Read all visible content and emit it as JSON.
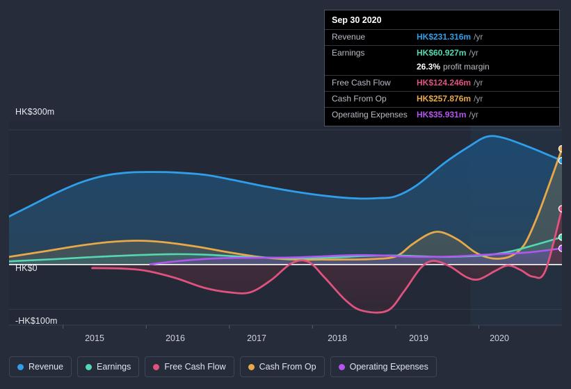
{
  "chart_data": {
    "type": "area",
    "title": "",
    "xlabel": "",
    "ylabel": "",
    "currency": "HK$",
    "xlim": [
      2014.35,
      2021.0
    ],
    "ylim": [
      -130,
      330
    ],
    "grid": true,
    "y_ticks": [
      {
        "value": 300,
        "label": "HK$300m"
      },
      {
        "value": 200,
        "label": ""
      },
      {
        "value": 100,
        "label": ""
      },
      {
        "value": 0,
        "label": "HK$0"
      },
      {
        "value": -100,
        "label": "-HK$100m"
      }
    ],
    "x_ticks": [
      {
        "value": 2015,
        "label": "2015"
      },
      {
        "value": 2016,
        "label": "2016"
      },
      {
        "value": 2017,
        "label": "2017"
      },
      {
        "value": 2018,
        "label": "2018"
      },
      {
        "value": 2019,
        "label": "2019"
      },
      {
        "value": 2020,
        "label": "2020"
      }
    ],
    "legend_position": "bottom-left",
    "series": [
      {
        "name": "Revenue",
        "color": "#2f9fea",
        "values": [
          [
            2014.35,
            107
          ],
          [
            2014.6,
            130
          ],
          [
            2014.9,
            158
          ],
          [
            2015.2,
            182
          ],
          [
            2015.5,
            198
          ],
          [
            2015.8,
            205
          ],
          [
            2016.1,
            206
          ],
          [
            2016.35,
            205
          ],
          [
            2016.7,
            200
          ],
          [
            2017.0,
            190
          ],
          [
            2017.4,
            175
          ],
          [
            2017.8,
            162
          ],
          [
            2018.2,
            152
          ],
          [
            2018.55,
            147
          ],
          [
            2018.8,
            148
          ],
          [
            2019.0,
            152
          ],
          [
            2019.25,
            176
          ],
          [
            2019.6,
            228
          ],
          [
            2019.9,
            265
          ],
          [
            2020.1,
            285
          ],
          [
            2020.3,
            282
          ],
          [
            2020.6,
            262
          ],
          [
            2020.85,
            243
          ],
          [
            2021.0,
            231.316
          ]
        ]
      },
      {
        "name": "Earnings",
        "color": "#55d8b1",
        "values": [
          [
            2014.35,
            7
          ],
          [
            2014.9,
            12
          ],
          [
            2015.4,
            17
          ],
          [
            2015.9,
            21
          ],
          [
            2016.3,
            23
          ],
          [
            2016.7,
            22
          ],
          [
            2017.1,
            18
          ],
          [
            2017.5,
            15
          ],
          [
            2017.9,
            14
          ],
          [
            2018.3,
            16
          ],
          [
            2018.6,
            19
          ],
          [
            2018.9,
            20
          ],
          [
            2019.2,
            19
          ],
          [
            2019.5,
            17
          ],
          [
            2019.8,
            18
          ],
          [
            2020.1,
            21
          ],
          [
            2020.4,
            30
          ],
          [
            2020.7,
            45
          ],
          [
            2021.0,
            60.927
          ]
        ]
      },
      {
        "name": "Free Cash Flow",
        "color": "#e0537f",
        "values": [
          [
            2015.35,
            -8
          ],
          [
            2015.7,
            -9
          ],
          [
            2016.0,
            -14
          ],
          [
            2016.35,
            -30
          ],
          [
            2016.7,
            -52
          ],
          [
            2017.0,
            -62
          ],
          [
            2017.25,
            -62
          ],
          [
            2017.5,
            -35
          ],
          [
            2017.75,
            3
          ],
          [
            2017.95,
            6
          ],
          [
            2018.15,
            -30
          ],
          [
            2018.4,
            -80
          ],
          [
            2018.6,
            -103
          ],
          [
            2018.9,
            -103
          ],
          [
            2019.1,
            -60
          ],
          [
            2019.3,
            -8
          ],
          [
            2019.45,
            8
          ],
          [
            2019.65,
            -4
          ],
          [
            2019.85,
            -28
          ],
          [
            2020.0,
            -33
          ],
          [
            2020.2,
            -14
          ],
          [
            2020.35,
            -2
          ],
          [
            2020.5,
            -12
          ],
          [
            2020.65,
            -27
          ],
          [
            2020.8,
            -14
          ],
          [
            2021.0,
            124.246
          ]
        ]
      },
      {
        "name": "Cash From Op",
        "color": "#e7a94a",
        "values": [
          [
            2014.35,
            17
          ],
          [
            2014.8,
            30
          ],
          [
            2015.2,
            42
          ],
          [
            2015.55,
            50
          ],
          [
            2015.9,
            53
          ],
          [
            2016.2,
            50
          ],
          [
            2016.6,
            40
          ],
          [
            2017.0,
            27
          ],
          [
            2017.4,
            16
          ],
          [
            2017.8,
            11
          ],
          [
            2018.1,
            11
          ],
          [
            2018.4,
            11
          ],
          [
            2018.7,
            12
          ],
          [
            2019.0,
            18
          ],
          [
            2019.2,
            45
          ],
          [
            2019.4,
            68
          ],
          [
            2019.55,
            72
          ],
          [
            2019.75,
            55
          ],
          [
            2019.95,
            28
          ],
          [
            2020.1,
            16
          ],
          [
            2020.25,
            13
          ],
          [
            2020.4,
            20
          ],
          [
            2020.55,
            45
          ],
          [
            2020.7,
            105
          ],
          [
            2020.85,
            180
          ],
          [
            2021.0,
            257.876
          ]
        ]
      },
      {
        "name": "Operating Expenses",
        "color": "#b355f0",
        "values": [
          [
            2016.05,
            0.5
          ],
          [
            2016.3,
            6
          ],
          [
            2016.6,
            11
          ],
          [
            2016.9,
            14
          ],
          [
            2017.2,
            15
          ],
          [
            2017.5,
            15
          ],
          [
            2017.8,
            16
          ],
          [
            2018.1,
            18
          ],
          [
            2018.35,
            20
          ],
          [
            2018.6,
            21
          ],
          [
            2018.85,
            20
          ],
          [
            2019.1,
            18
          ],
          [
            2019.4,
            17
          ],
          [
            2019.7,
            18
          ],
          [
            2020.0,
            21
          ],
          [
            2020.3,
            24
          ],
          [
            2020.6,
            27
          ],
          [
            2021.0,
            35.931
          ]
        ]
      }
    ],
    "end_markers": [
      {
        "series": "Cash From Op",
        "value": 257.876,
        "color": "#e7a94a"
      },
      {
        "series": "Revenue",
        "value": 231.316,
        "color": "#2f9fea"
      },
      {
        "series": "Free Cash Flow",
        "value": 124.246,
        "color": "#e0537f"
      },
      {
        "series": "Earnings",
        "value": 60.927,
        "color": "#55d8b1"
      },
      {
        "series": "Operating Expenses",
        "value": 35.931,
        "color": "#b355f0"
      }
    ],
    "forecast_divider_year": 2019.9
  },
  "tooltip": {
    "title": "Sep 30 2020",
    "rows": [
      {
        "label": "Revenue",
        "value": "HK$231.316m",
        "unit": "/yr",
        "color": "#2f9fea"
      },
      {
        "label": "Earnings",
        "value": "HK$60.927m",
        "unit": "/yr",
        "color": "#55d8b1"
      },
      {
        "label": "Free Cash Flow",
        "value": "HK$124.246m",
        "unit": "/yr",
        "color": "#e0537f"
      },
      {
        "label": "Cash From Op",
        "value": "HK$257.876m",
        "unit": "/yr",
        "color": "#e7a94a"
      },
      {
        "label": "Operating Expenses",
        "value": "HK$35.931m",
        "unit": "/yr",
        "color": "#b355f0"
      }
    ],
    "profit_margin_value": "26.3%",
    "profit_margin_text": "profit margin"
  },
  "legend": {
    "items": [
      {
        "label": "Revenue",
        "color": "#2f9fea"
      },
      {
        "label": "Earnings",
        "color": "#55d8b1"
      },
      {
        "label": "Free Cash Flow",
        "color": "#e0537f"
      },
      {
        "label": "Cash From Op",
        "color": "#e7a94a"
      },
      {
        "label": "Operating Expenses",
        "color": "#b355f0"
      }
    ]
  },
  "colors": {
    "page_background": "#262c3a",
    "plot_background": "#232936",
    "plot_background_forecast": "#24303f",
    "zero_line": "#ffffff",
    "grid_line": "#3b4250",
    "tooltip_background": "#000000"
  }
}
